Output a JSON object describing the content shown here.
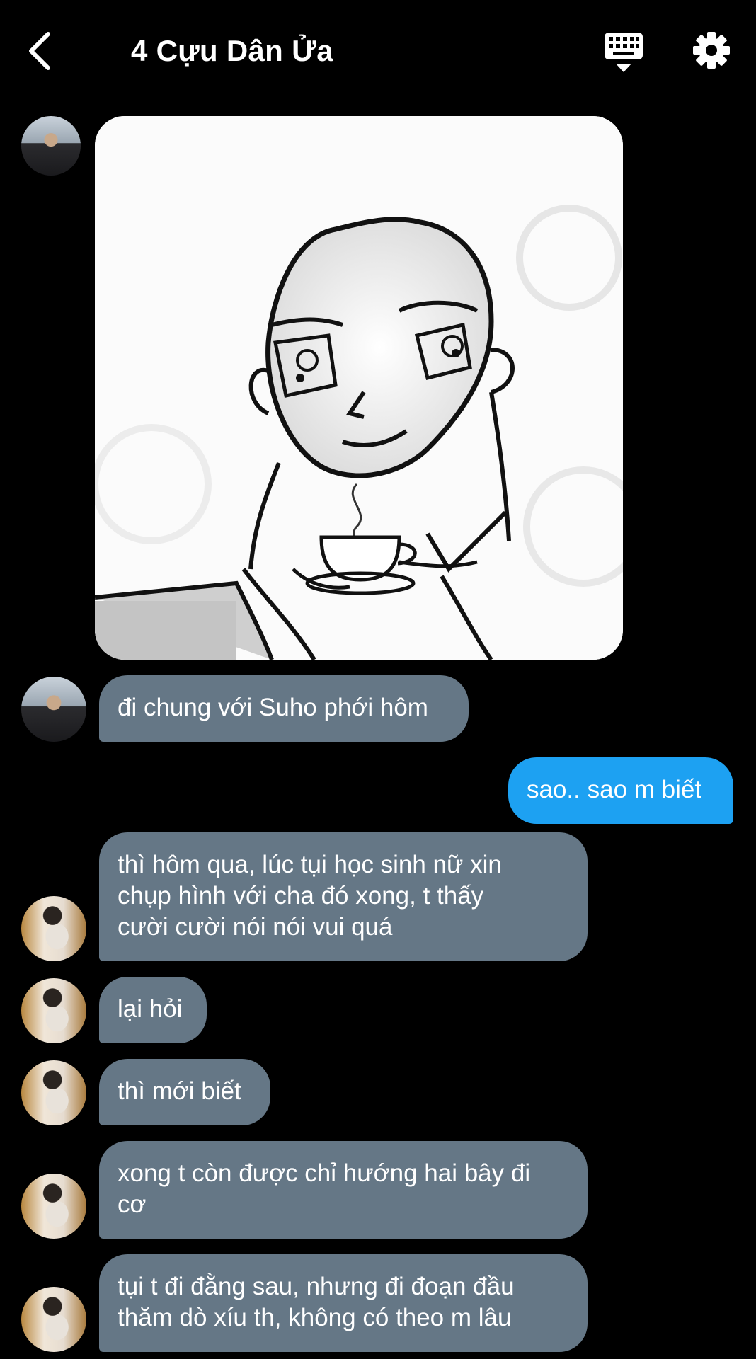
{
  "header": {
    "title": "4 Cựu Dân Ửa",
    "back_icon": "chevron-left-icon",
    "keyboard_icon": "keyboard-icon",
    "settings_icon": "gear-icon"
  },
  "colors": {
    "background": "#000000",
    "incoming_bubble": "#657786",
    "outgoing_bubble": "#1da1f2",
    "text": "#ffffff"
  },
  "messages": [
    {
      "type": "image",
      "from": "other",
      "content": "sketch of a man holding a cup of coffee"
    },
    {
      "type": "text",
      "from": "other",
      "text": "đi chung với Suho phới hôm"
    },
    {
      "type": "text",
      "from": "me",
      "text": "sao.. sao m biết"
    },
    {
      "type": "text",
      "from": "other",
      "lines": [
        "thì hôm qua, lúc tụi học sinh nữ xin",
        "chụp hình với cha đó xong, t thấy",
        "cười cười nói nói vui quá"
      ]
    },
    {
      "type": "text",
      "from": "other",
      "text": "lại hỏi"
    },
    {
      "type": "text",
      "from": "other",
      "text": "thì mới biết"
    },
    {
      "type": "text",
      "from": "other",
      "lines": [
        "xong t còn được chỉ hướng hai bây đi",
        "cơ"
      ]
    },
    {
      "type": "text",
      "from": "other",
      "lines": [
        "tụi t đi đằng sau, nhưng đi đoạn đầu",
        "thăm dò xíu th, không có theo m lâu"
      ]
    }
  ]
}
